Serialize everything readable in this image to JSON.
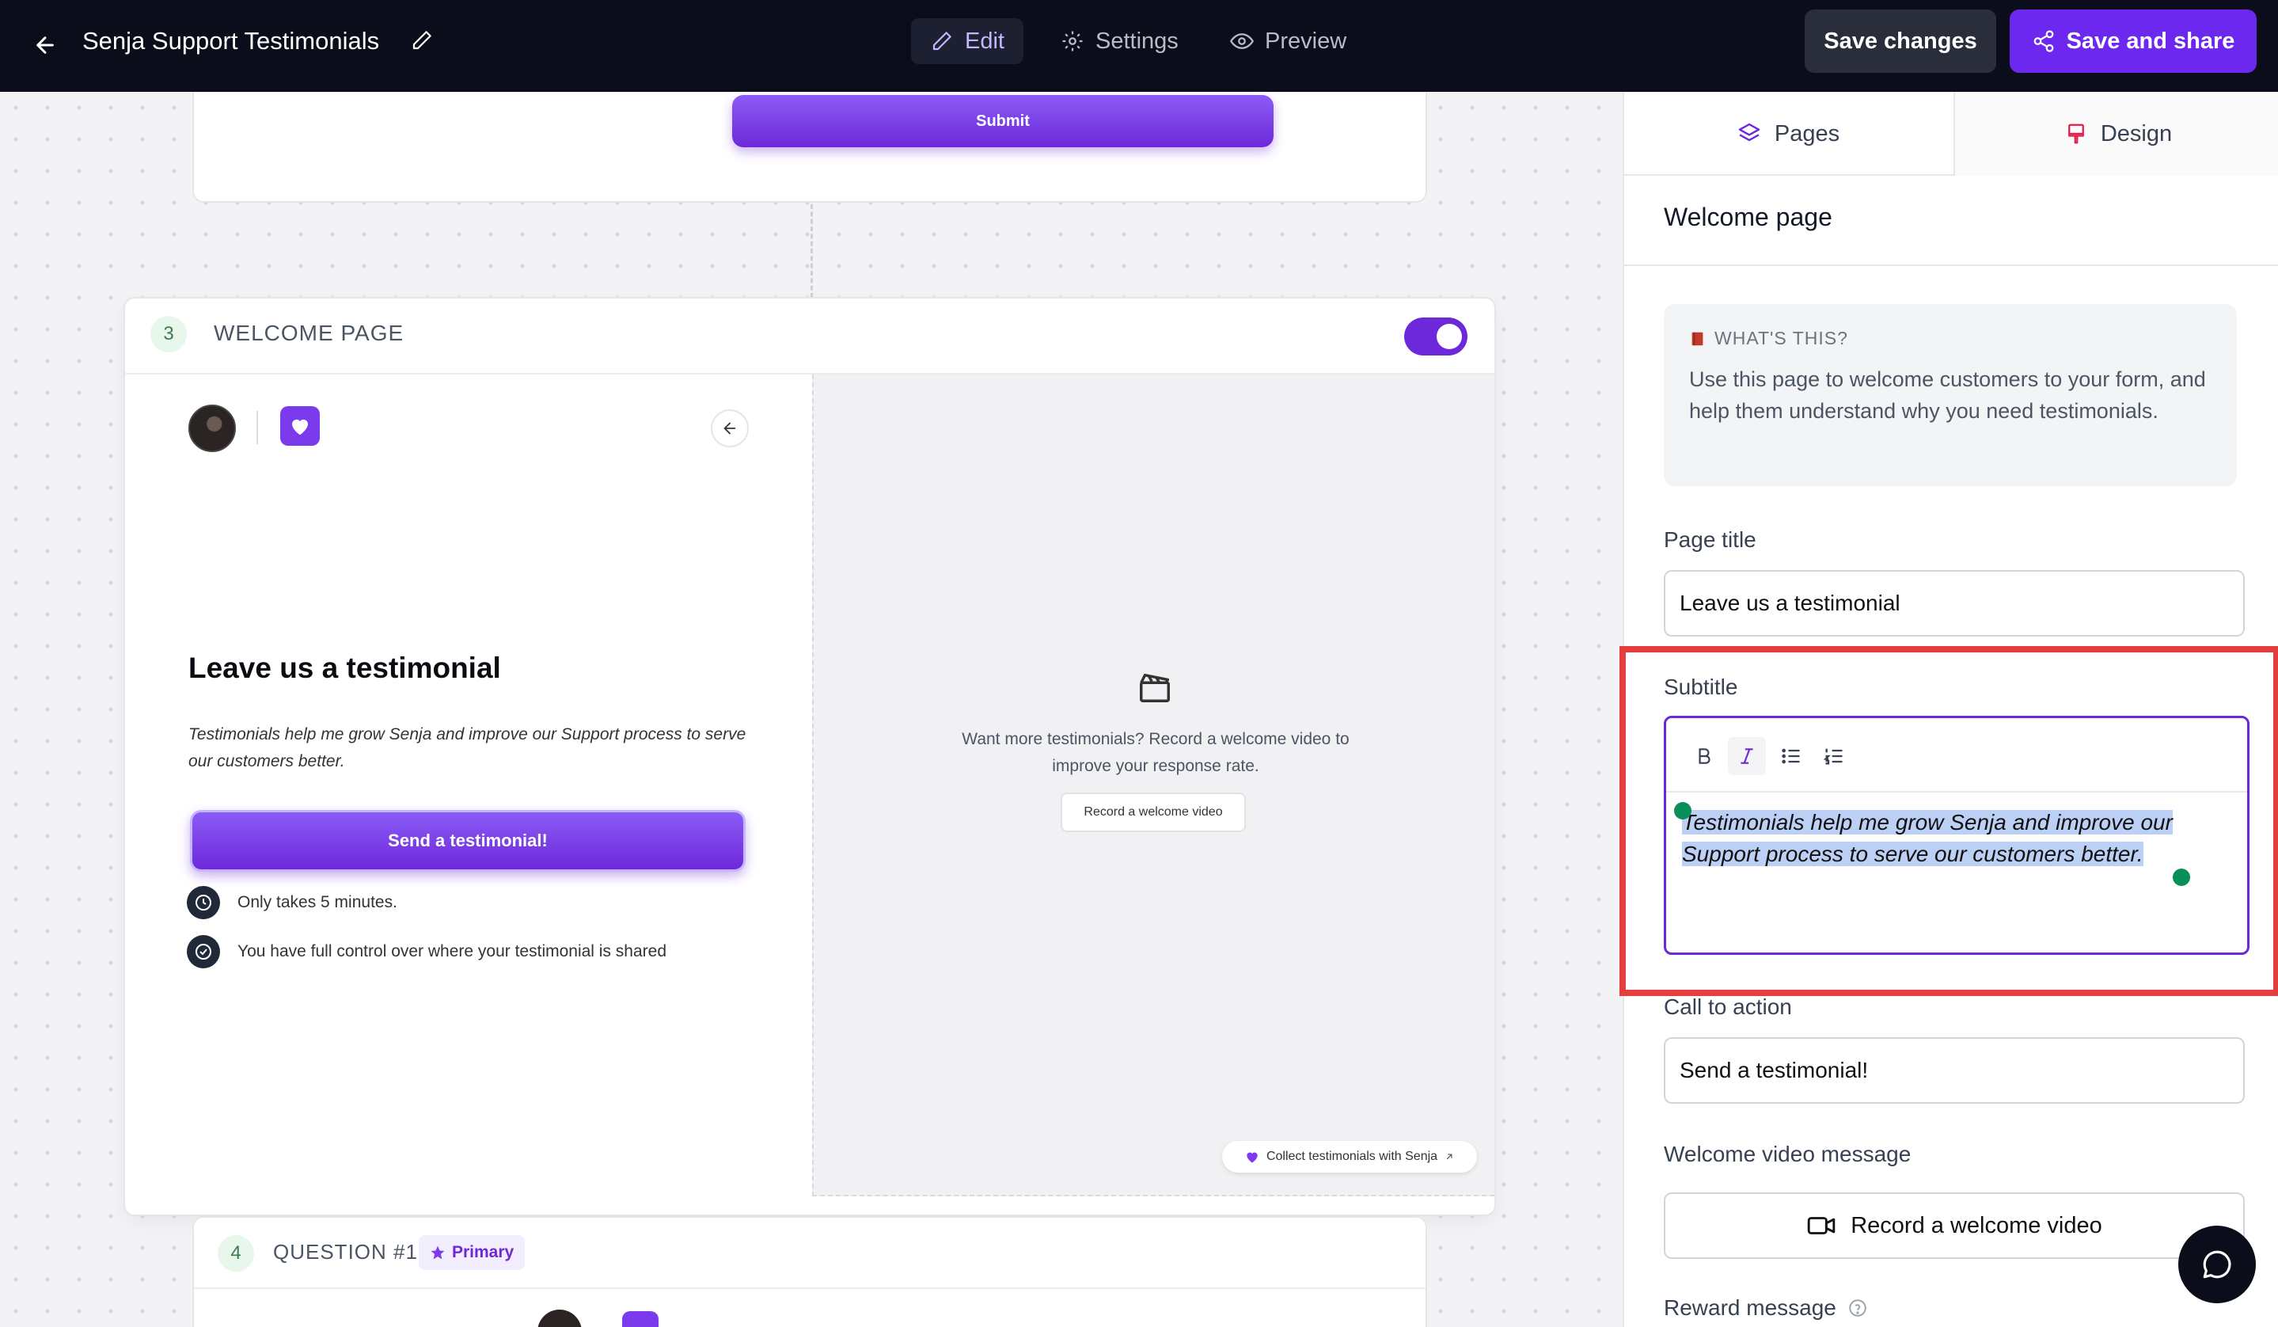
{
  "topbar": {
    "title": "Senja Support Testimonials",
    "tabs": [
      {
        "label": "Edit",
        "icon": "pencil-icon"
      },
      {
        "label": "Settings",
        "icon": "gear-icon"
      },
      {
        "label": "Preview",
        "icon": "eye-icon"
      }
    ],
    "save_changes": "Save changes",
    "save_and_share": "Save and share"
  },
  "canvas": {
    "submit_label": "Submit",
    "welcome": {
      "step_number": "3",
      "step_label": "WELCOME PAGE",
      "enabled": true,
      "title": "Leave us a testimonial",
      "subtitle": "Testimonials help me grow Senja and improve our Support process to serve our customers better.",
      "cta": "Send a testimonial!",
      "bullets": [
        "Only takes 5 minutes.",
        "You have full control over where your testimonial is shared"
      ],
      "video_prompt": "Want more testimonials? Record a welcome video to improve your response rate.",
      "record_small": "Record a welcome video",
      "collect_badge": "Collect testimonials with Senja"
    },
    "question": {
      "step_number": "4",
      "step_label": "QUESTION #1",
      "badge": "Primary"
    }
  },
  "sidebar": {
    "tabs": [
      "Pages",
      "Design"
    ],
    "heading": "Welcome page",
    "info_label": "WHAT'S THIS?",
    "info_text": "Use this page to welcome customers to your form, and help them understand why you need testimonials.",
    "page_title_label": "Page title",
    "page_title_value": "Leave us a testimonial",
    "subtitle_label": "Subtitle",
    "subtitle_value": "Testimonials help me grow Senja and improve our Support process to serve our customers better.",
    "cta_label": "Call to action",
    "cta_value": "Send a testimonial!",
    "video_label": "Welcome video message",
    "video_button": "Record a welcome video",
    "reward_label": "Reward message"
  },
  "colors": {
    "accent": "#6d28d9",
    "topbar_bg": "#0b0e1a",
    "highlight_box": "#e53e3e",
    "selection": "#bcd0f5"
  }
}
